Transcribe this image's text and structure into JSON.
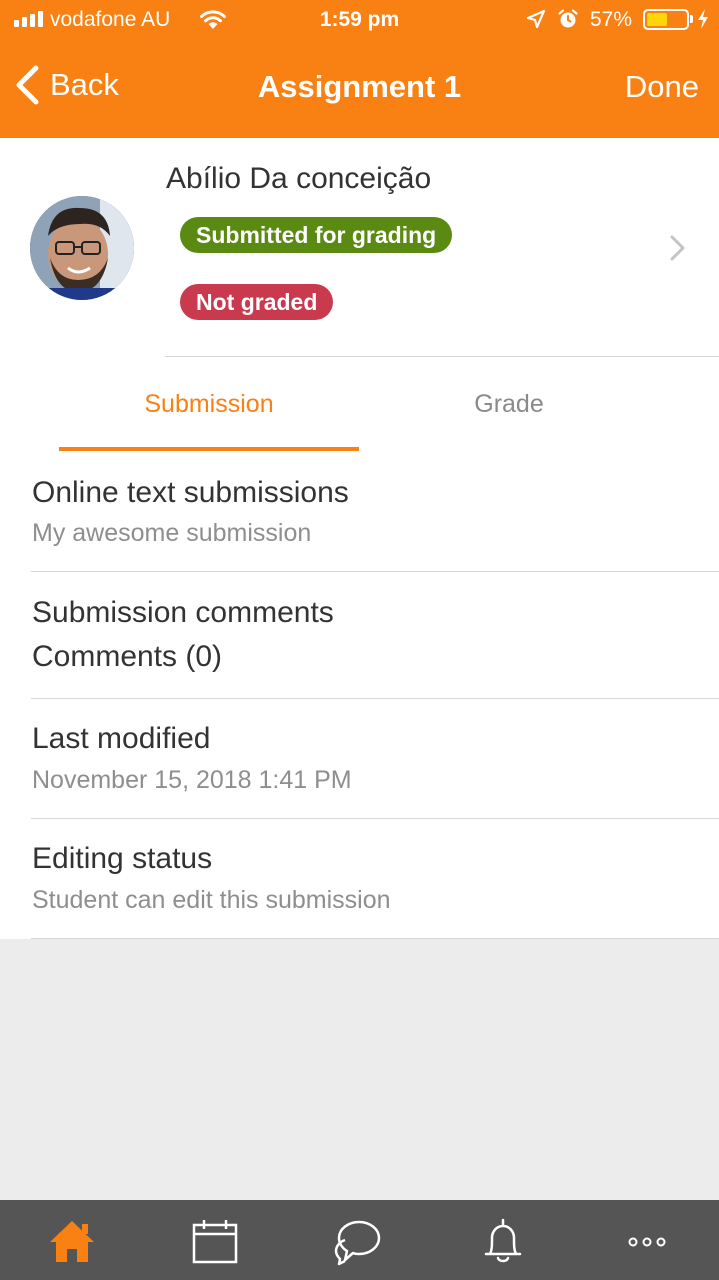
{
  "status_bar": {
    "carrier": "vodafone AU",
    "time": "1:59 pm",
    "battery_percent": "57%",
    "battery_level": 0.57,
    "icons": [
      "signal-icon",
      "wifi-icon",
      "location-icon",
      "alarm-icon",
      "battery-icon",
      "charging-icon"
    ]
  },
  "nav": {
    "back_label": "Back",
    "title": "Assignment 1",
    "done_label": "Done"
  },
  "user": {
    "name": "Abílio Da conceição",
    "badges": {
      "submission": "Submitted for grading",
      "grading": "Not graded"
    }
  },
  "tabs": [
    {
      "label": "Submission",
      "active": true
    },
    {
      "label": "Grade",
      "active": false
    }
  ],
  "details": [
    {
      "label": "Online text submissions",
      "value": "My awesome submission"
    },
    {
      "label": "Submission comments",
      "value": "Comments (0)"
    },
    {
      "label": "Last modified",
      "value": "November 15, 2018 1:41 PM"
    },
    {
      "label": "Editing status",
      "value": "Student can edit this submission"
    }
  ],
  "bottom_nav": {
    "items": [
      "home-icon",
      "calendar-icon",
      "messages-icon",
      "notifications-icon",
      "more-icon"
    ],
    "active": "home-icon"
  },
  "colors": {
    "brand": "#f98012",
    "badge_green": "#5b8a12",
    "badge_red": "#ca3a4f",
    "bottom_bar": "#555555"
  }
}
